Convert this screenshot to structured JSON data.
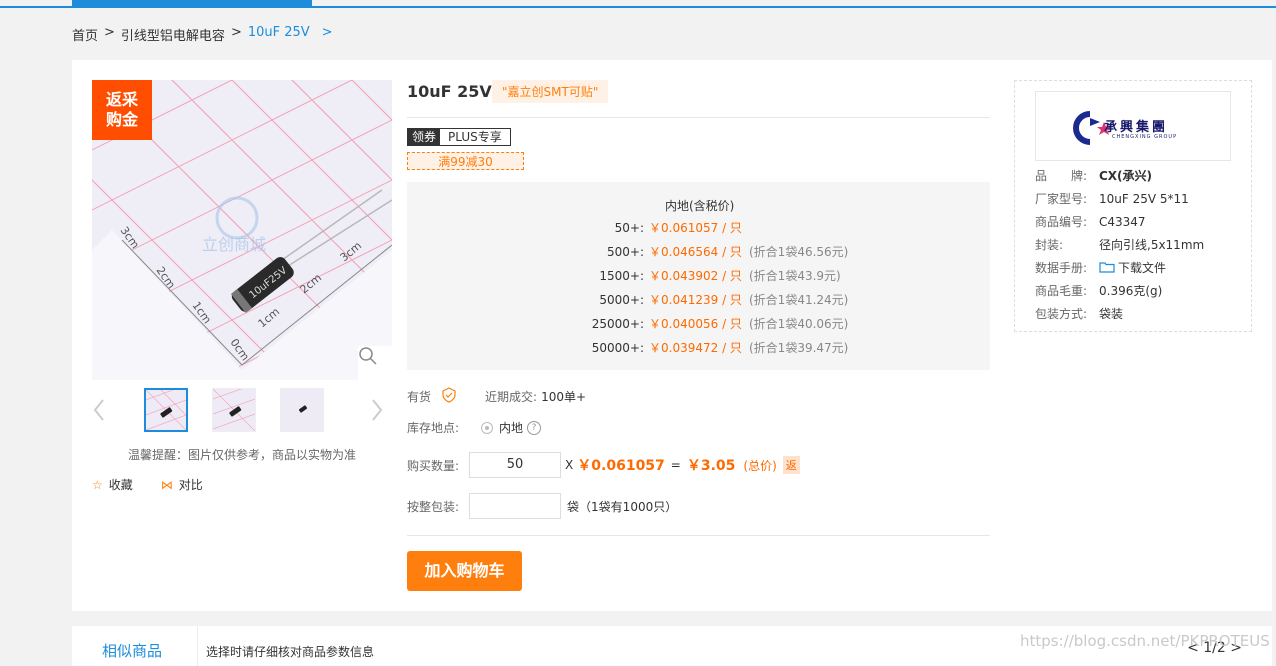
{
  "breadcrumb": {
    "home": "首页",
    "sep1": ">",
    "category": "引线型铝电解电容",
    "sep2": ">",
    "current": "10uF 25V",
    "sep3": ">"
  },
  "gallery": {
    "badge_line1": "返采",
    "badge_line2": "购金",
    "zoom_icon": "search-icon",
    "prev_icon": "chevron-left-icon",
    "next_icon": "chevron-right-icon",
    "tip": "温馨提醒：图片仅供参考，商品以实物为准",
    "favorite": "收藏",
    "compare": "对比"
  },
  "product": {
    "title": "10uF 25V",
    "smt_tag": "\"嘉立创SMT可贴\"",
    "coupon_label": "领券",
    "coupon_text": "PLUS专享",
    "discount": "满99减30"
  },
  "prices": {
    "header": "内地(含税价)",
    "rows": [
      {
        "qty": "50+:",
        "price": "￥0.061057 / 只",
        "pack": ""
      },
      {
        "qty": "500+:",
        "price": "￥0.046564 / 只",
        "pack": "(折合1袋46.56元)"
      },
      {
        "qty": "1500+:",
        "price": "￥0.043902 / 只",
        "pack": "(折合1袋43.9元)"
      },
      {
        "qty": "5000+:",
        "price": "￥0.041239 / 只",
        "pack": "(折合1袋41.24元)"
      },
      {
        "qty": "25000+:",
        "price": "￥0.040056 / 只",
        "pack": "(折合1袋40.06元)"
      },
      {
        "qty": "50000+:",
        "price": "￥0.039472 / 只",
        "pack": "(折合1袋39.47元)"
      }
    ]
  },
  "stock": {
    "label": "有货",
    "recent_label": "近期成交:",
    "recent_value": "100单+"
  },
  "warehouse": {
    "label": "库存地点:",
    "value": "内地"
  },
  "purchase": {
    "qty_label": "购买数量:",
    "qty_value": "50",
    "x": "X",
    "unit_price": "￥0.061057",
    "eq": "=",
    "total": "￥3.05",
    "total_label": "(总价)",
    "rebate": "返",
    "pack_label": "按整包装:",
    "pack_value": "",
    "pack_unit": "袋（1袋有1000只）",
    "add_to_cart": "加入购物车"
  },
  "brand": {
    "logo_text": "承興集團",
    "logo_sub": "CHENGXING GROUP",
    "specs": [
      {
        "k": "品　　牌:",
        "v": "CX(承兴)"
      },
      {
        "k": "厂家型号:",
        "v": "10uF 25V 5*11"
      },
      {
        "k": "商品编号:",
        "v": "C43347"
      },
      {
        "k": "封装:",
        "v": "径向引线,5x11mm"
      },
      {
        "k": "数据手册:",
        "v": "下载文件"
      },
      {
        "k": "商品毛重:",
        "v": "0.396克(g)"
      },
      {
        "k": "包装方式:",
        "v": "袋装"
      }
    ]
  },
  "bottom": {
    "tab": "相似商品",
    "note": "选择时请仔细核对商品参数信息",
    "pager": "<  1/2  >"
  },
  "watermark": "https://blog.csdn.net/PKPROTEUS",
  "colors": {
    "accent": "#1d8ddb",
    "price": "#ff6a00",
    "cart": "#ff7f0e",
    "badge": "#ff4e02"
  }
}
